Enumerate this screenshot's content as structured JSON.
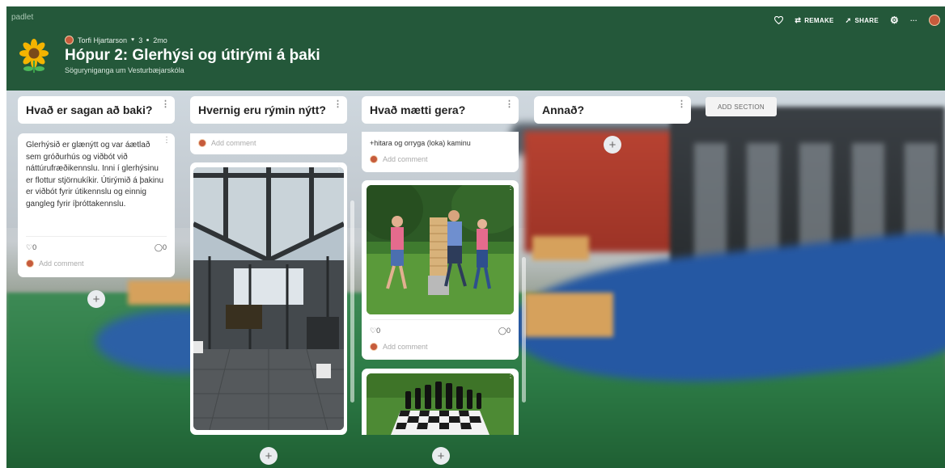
{
  "header": {
    "brand": "padlet",
    "author": "Torfi Hjartarson",
    "likes": "3",
    "time": "2mo",
    "title": "Hópur 2: Glerhýsi og útirými á þaki",
    "subtitle": "Söguryniganga um Vesturbæjarskóla",
    "toolbar": {
      "remake": "REMAKE",
      "share": "SHARE",
      "more": "···"
    }
  },
  "columns": [
    {
      "title": "Hvað er sagan að baki?"
    },
    {
      "title": "Hvernig eru rýmin nýtt?"
    },
    {
      "title": "Hvað mætti gera?"
    },
    {
      "title": "Annað?"
    }
  ],
  "add_section": "ADD SECTION",
  "cards": {
    "c1": {
      "text": "Glerhýsið er glænýtt og var áætlað sem gróðurhús og viðbót við náttúrufræðikennslu. Inni í glerhýsinu er flottur stjörnukíkir. Útirýmið á þakinu er viðbót fyrir útikennslu og einnig gangleg fyrir íþróttakennslu.",
      "likes": "0",
      "comments": "0",
      "add_comment": "Add comment"
    },
    "c2": {
      "add_comment": "Add comment"
    },
    "c3": {
      "text": "+hitara og orryga (loka) kaminu",
      "add_comment": "Add comment"
    },
    "c4": {
      "likes": "0",
      "comments": "0",
      "add_comment": "Add comment"
    }
  },
  "icons": {
    "heart": "heart-icon",
    "comment": "comment-icon",
    "gear": "gear-icon",
    "plus": "plus-icon"
  },
  "colors": {
    "header_bg": "#24583a",
    "card_bg": "#ffffff"
  }
}
